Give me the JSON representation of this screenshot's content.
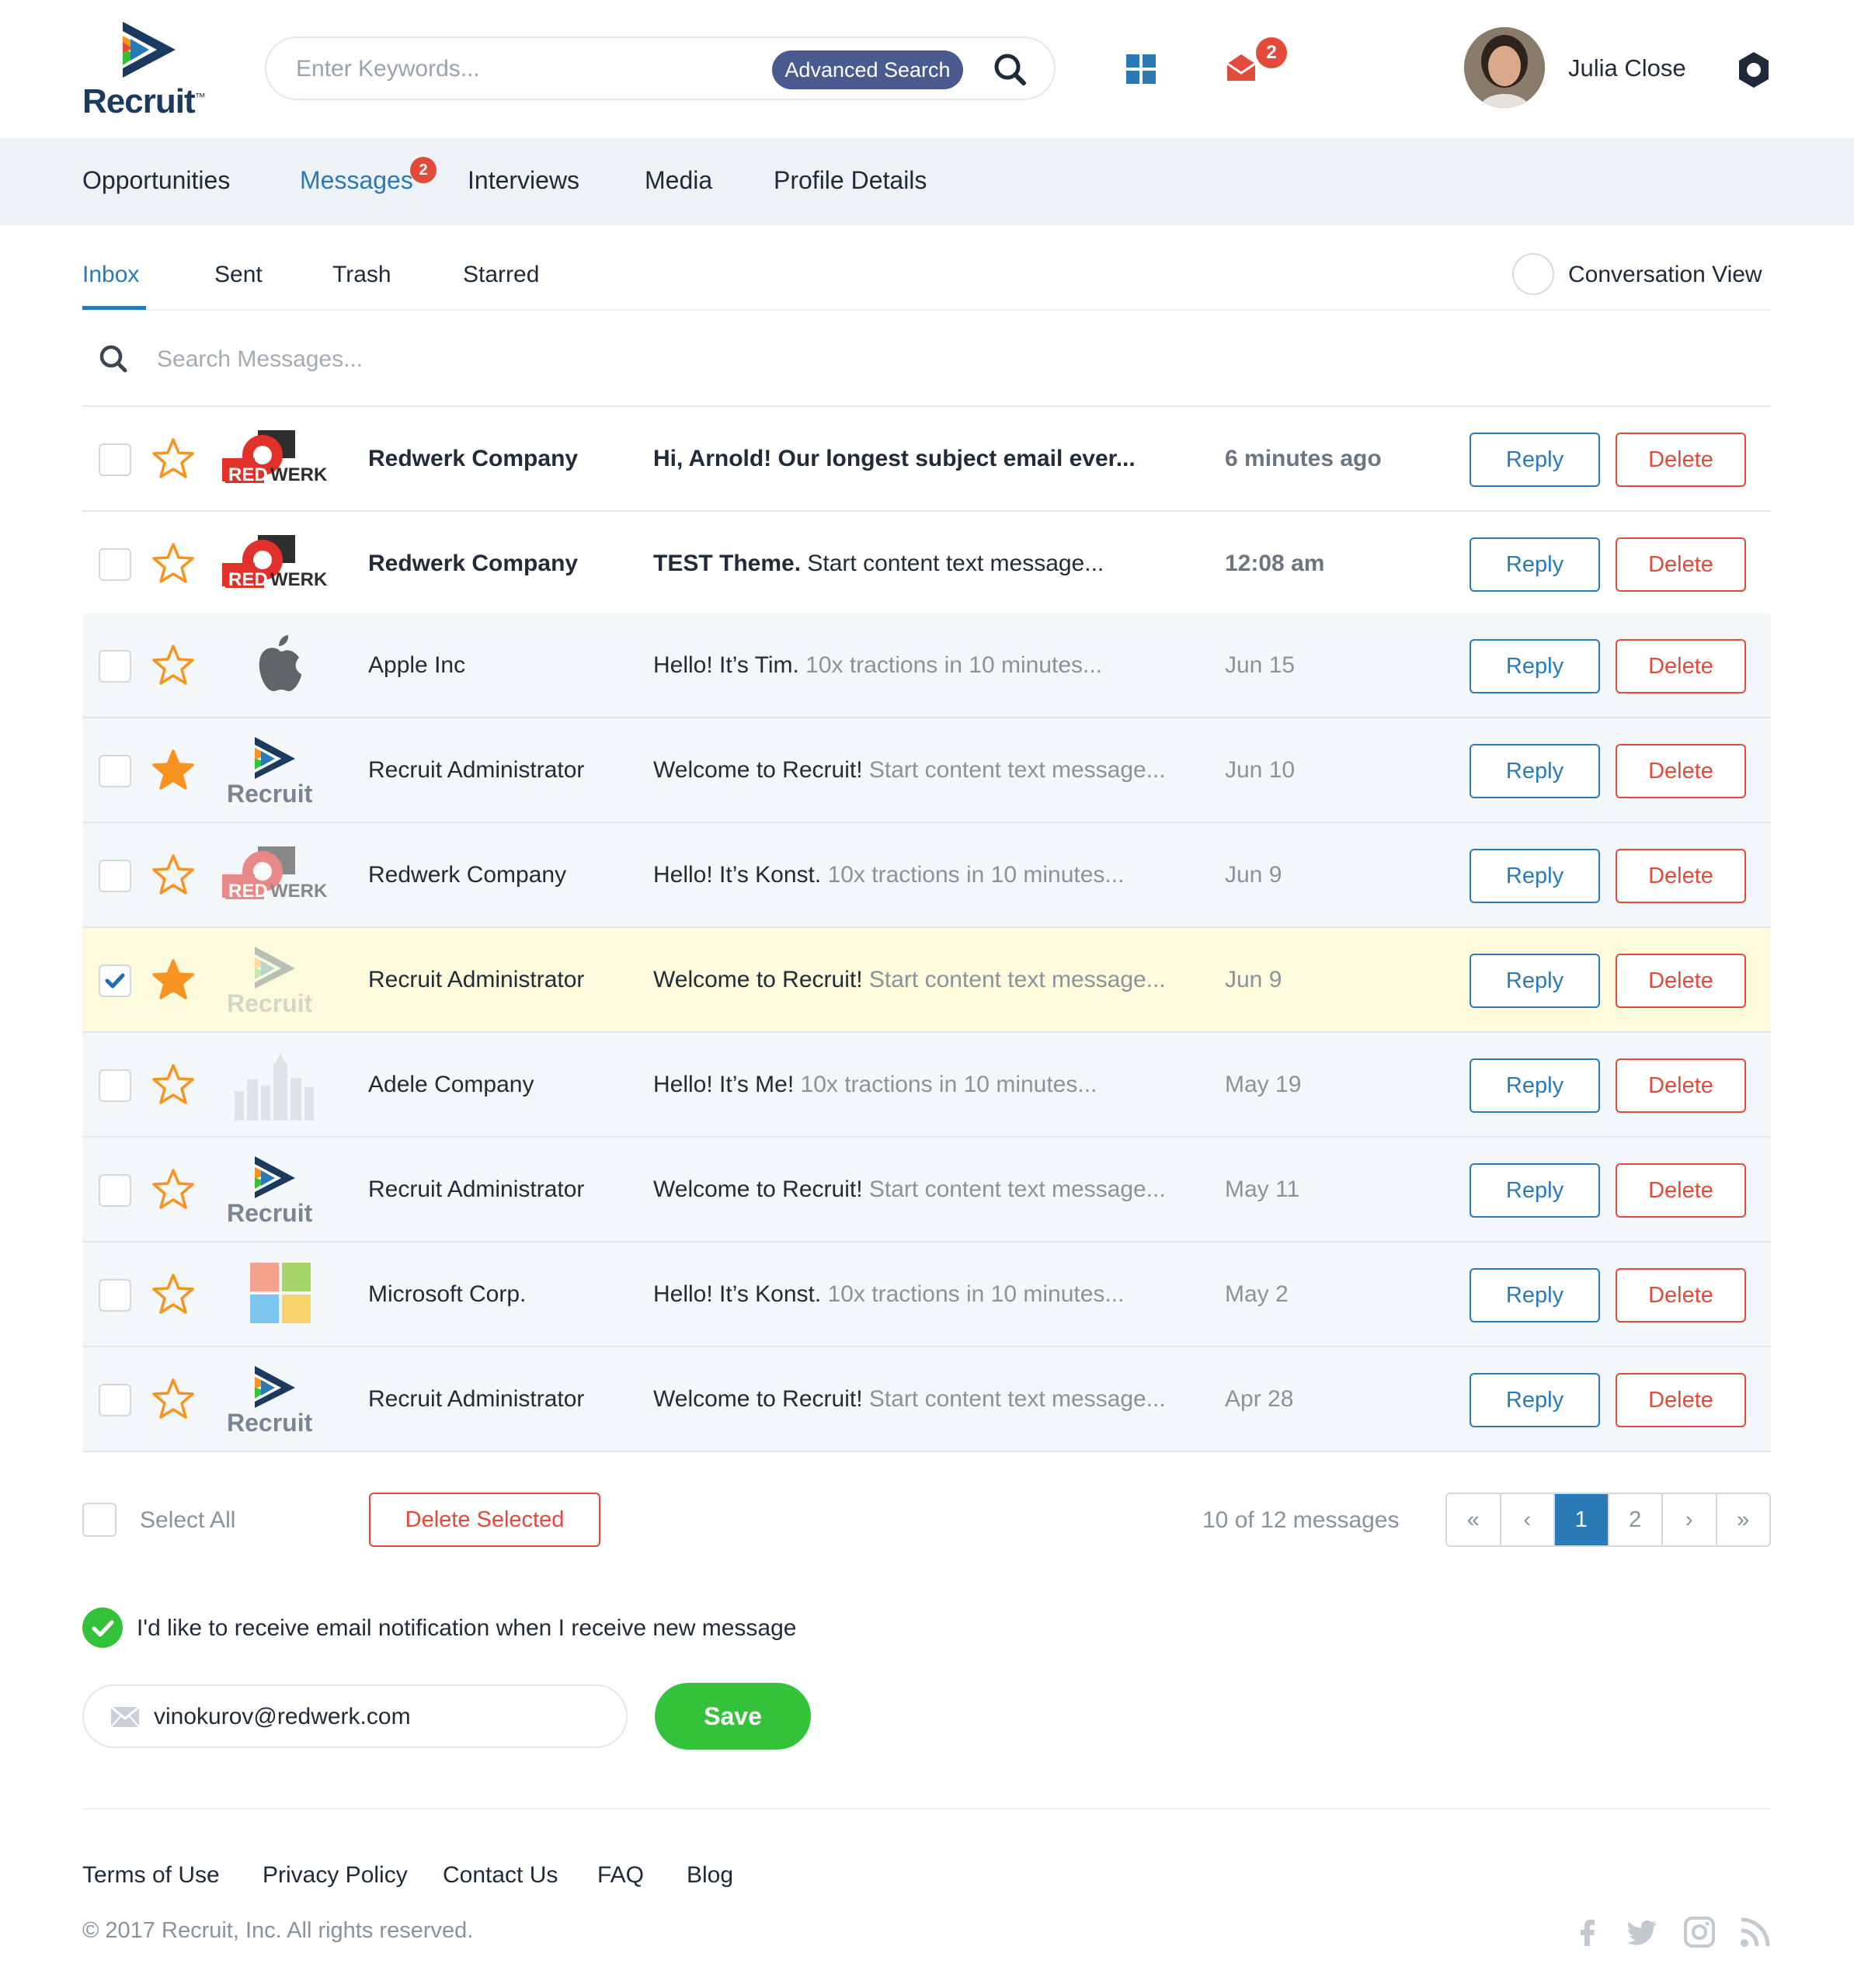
{
  "app": {
    "brand": "Recruit",
    "trademark": "™"
  },
  "header": {
    "search_placeholder": "Enter Keywords...",
    "advanced_search_label": "Advanced Search",
    "mail_badge": "2",
    "user_name": "Julia Close"
  },
  "main_nav": {
    "items": [
      {
        "label": "Opportunities"
      },
      {
        "label": "Messages",
        "badge": "2"
      },
      {
        "label": "Interviews"
      },
      {
        "label": "Media"
      },
      {
        "label": "Profile Details"
      }
    ],
    "active": "Messages"
  },
  "sub_tabs": {
    "items": [
      {
        "label": "Inbox"
      },
      {
        "label": "Sent"
      },
      {
        "label": "Trash"
      },
      {
        "label": "Starred"
      }
    ],
    "active": "Inbox",
    "conversation_view_label": "Conversation View"
  },
  "message_search": {
    "placeholder": "Search Messages..."
  },
  "messages": [
    {
      "sender": "Redwerk Company",
      "subject": "Hi, Arnold! Our longest subject email ever...",
      "preview": "",
      "date": "6 minutes ago",
      "logo": "redwerk-logo",
      "starred": false,
      "checked": false,
      "unread": true,
      "reply_label": "Reply",
      "delete_label": "Delete"
    },
    {
      "sender": "Redwerk Company",
      "subject": "TEST Theme.",
      "preview": "Start content text message...",
      "date": "12:08 am",
      "logo": "redwerk-logo",
      "starred": false,
      "checked": false,
      "unread": true,
      "reply_label": "Reply",
      "delete_label": "Delete"
    },
    {
      "sender": "Apple Inc",
      "subject": "Hello! It’s Tim.",
      "preview": "10x tractions in 10 minutes...",
      "date": "Jun 15",
      "logo": "apple-logo",
      "starred": false,
      "checked": false,
      "unread": false,
      "reply_label": "Reply",
      "delete_label": "Delete"
    },
    {
      "sender": "Recruit Administrator",
      "subject": "Welcome to Recruit!",
      "preview": "Start content text message...",
      "date": "Jun 10",
      "logo": "recruit-logo",
      "starred": true,
      "checked": false,
      "unread": false,
      "reply_label": "Reply",
      "delete_label": "Delete"
    },
    {
      "sender": "Redwerk Company",
      "subject": "Hello! It’s Konst.",
      "preview": "10x tractions in 10 minutes...",
      "date": "Jun 9",
      "logo": "redwerk-logo",
      "starred": false,
      "checked": false,
      "unread": false,
      "reply_label": "Reply",
      "delete_label": "Delete"
    },
    {
      "sender": "Recruit Administrator",
      "subject": "Welcome to Recruit!",
      "preview": "Start content text message...",
      "date": "Jun 9",
      "logo": "recruit-logo",
      "starred": true,
      "checked": true,
      "unread": false,
      "reply_label": "Reply",
      "delete_label": "Delete"
    },
    {
      "sender": "Adele Company",
      "subject": "Hello! It’s Me!",
      "preview": "10x tractions in 10 minutes...",
      "date": "May 19",
      "logo": "city-logo",
      "starred": false,
      "checked": false,
      "unread": false,
      "reply_label": "Reply",
      "delete_label": "Delete"
    },
    {
      "sender": "Recruit Administrator",
      "subject": "Welcome to Recruit!",
      "preview": "Start content text message...",
      "date": "May 11",
      "logo": "recruit-logo",
      "starred": false,
      "checked": false,
      "unread": false,
      "reply_label": "Reply",
      "delete_label": "Delete"
    },
    {
      "sender": "Microsoft Corp.",
      "subject": "Hello! It’s Konst.",
      "preview": "10x tractions in 10 minutes...",
      "date": "May 2",
      "logo": "microsoft-logo",
      "starred": false,
      "checked": false,
      "unread": false,
      "reply_label": "Reply",
      "delete_label": "Delete"
    },
    {
      "sender": "Recruit Administrator",
      "subject": "Welcome to Recruit!",
      "preview": "Start content text message...",
      "date": "Apr 28",
      "logo": "recruit-logo",
      "starred": false,
      "checked": false,
      "unread": false,
      "reply_label": "Reply",
      "delete_label": "Delete"
    }
  ],
  "bulk": {
    "select_all_label": "Select All",
    "delete_selected_label": "Delete Selected",
    "count_label": "10 of 12 messages"
  },
  "pagination": {
    "first": "«",
    "prev": "‹",
    "pages": [
      "1",
      "2"
    ],
    "current": "1",
    "next": "›",
    "last": "»"
  },
  "notifications": {
    "label": "I'd like to receive email notification when I receive new message",
    "enabled": true,
    "email": "vinokurov@redwerk.com",
    "save_label": "Save"
  },
  "footer": {
    "links": [
      "Terms of Use",
      "Privacy Policy",
      "Contact Us",
      "FAQ",
      "Blog"
    ],
    "copyright": "© 2017 Recruit, Inc. All rights reserved.",
    "social_icons": [
      "facebook-icon",
      "twitter-icon",
      "instagram-icon",
      "rss-icon"
    ]
  },
  "colors": {
    "accent_blue": "#2a7ab6",
    "danger_red": "#e24a3b",
    "success_green": "#35c23b",
    "star_orange": "#f7931e",
    "selected_row": "#fefbdc",
    "nav_bg": "#eef2f6",
    "advanced_search_bg": "#4a5a8e"
  }
}
